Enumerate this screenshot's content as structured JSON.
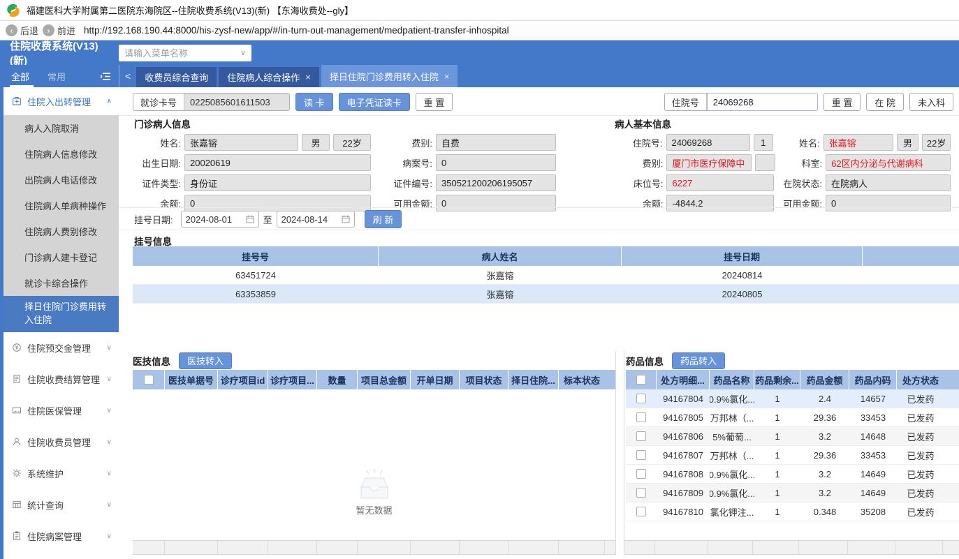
{
  "window": {
    "title": "福建医科大学附属第二医院东海院区--住院收费系统(V13)(新) 【东海收费处--gly】"
  },
  "browser": {
    "back": "后退",
    "forward": "前进",
    "url": "http://192.168.190.44:8000/his-zysf-new/app/#/in-turn-out-management/medpatient-transfer-inhospital"
  },
  "header": {
    "app_title": "住院收费系统(V13)(新)",
    "menu_search_placeholder": "请输入菜单名称"
  },
  "icons": {
    "caret_up": "∧",
    "caret_down": "∨",
    "search_caret": "∨",
    "chevron_left": "<",
    "close": "×",
    "back_arrow": "‹",
    "forward_arrow": "›"
  },
  "nav": {
    "filter_all": "全部",
    "filter_common": "常用",
    "tabs": [
      {
        "label": "收费员综合查询",
        "closable": false,
        "active": false
      },
      {
        "label": "住院病人综合操作",
        "closable": true,
        "active": false
      },
      {
        "label": "择日住院门诊费用转入住院",
        "closable": true,
        "active": true
      }
    ]
  },
  "sidebar": {
    "group_top": {
      "label": "住院入出转管理",
      "icon": "inout-manage-icon"
    },
    "items": [
      "病人入院取消",
      "住院病人信息修改",
      "出院病人电话修改",
      "住院病人单病种操作",
      "住院病人费别修改",
      "门诊病人建卡登记",
      "就诊卡综合操作",
      "择日住院门诊费用转入住院"
    ],
    "selected_index": 7,
    "groups": [
      {
        "label": "住院预交金管理",
        "icon": "deposit-icon"
      },
      {
        "label": "住院收费结算管理",
        "icon": "billing-icon"
      },
      {
        "label": "住院医保管理",
        "icon": "insurance-card-icon"
      },
      {
        "label": "住院收费员管理",
        "icon": "cashier-icon"
      },
      {
        "label": "系统维护",
        "icon": "gear-icon"
      },
      {
        "label": "统计查询",
        "icon": "stats-icon"
      },
      {
        "label": "住院病案管理",
        "icon": "records-icon"
      }
    ]
  },
  "toolbar": {
    "card_label": "就诊卡号",
    "card_value": "0225085601611503",
    "read_card": "读 卡",
    "e_cert_read": "电子凭证读卡",
    "reset": "重 置",
    "inpatient_label": "住院号",
    "inpatient_value": "24069268",
    "reset2": "重 置",
    "in_hospital": "在 院",
    "not_in_dept": "未入科"
  },
  "outpatient": {
    "title": "门诊病人信息",
    "name_label": "姓名:",
    "name": "张嘉镕",
    "sex": "男",
    "age": "22岁",
    "fee_label": "费别:",
    "fee": "自费",
    "birth_label": "出生日期:",
    "birth": "20020619",
    "case_label": "病案号:",
    "case_no": "0",
    "idtype_label": "证件类型:",
    "idtype": "身份证",
    "idno_label": "证件编号:",
    "idno": "350521200206195057",
    "balance_label": "余额:",
    "balance": "0",
    "avail_label": "可用金额:",
    "avail": "0"
  },
  "inpatient": {
    "title": "病人基本信息",
    "no_label": "住院号:",
    "no": "24069268",
    "times": "1",
    "name_label": "姓名:",
    "name": "张嘉镕",
    "sex": "男",
    "age": "22岁",
    "fee_label": "费别:",
    "fee": "厦门市医疗保障中",
    "dept_label": "科室:",
    "dept": "62区内分泌与代谢病科",
    "bed_label": "床位号:",
    "bed": "6227",
    "status_label": "在院状态:",
    "status": "在院病人",
    "balance_label": "余额:",
    "balance": "-4844.2",
    "avail_label": "可用金额:",
    "avail": "0"
  },
  "reg_filter": {
    "label": "挂号日期:",
    "from": "2024-08-01",
    "to_word": "至",
    "to": "2024-08-14",
    "refresh": "刷 新"
  },
  "reg_table": {
    "title": "挂号信息",
    "headers": [
      "挂号号",
      "病人姓名",
      "挂号日期",
      ""
    ],
    "rows": [
      [
        "63451724",
        "张嘉镕",
        "20240814"
      ],
      [
        "63353859",
        "张嘉镕",
        "20240805"
      ]
    ]
  },
  "medtech": {
    "title": "医技信息",
    "transfer_btn": "医技转入",
    "headers": [
      "医技单据号",
      "诊疗项目id",
      "诊疗项目...",
      "数量",
      "项目总金额",
      "开单日期",
      "项目状态",
      "择日住院...",
      "标本状态"
    ],
    "empty_text": "暂无数据"
  },
  "drugs": {
    "title": "药品信息",
    "transfer_btn": "药品转入",
    "headers": [
      "处方明细...",
      "药品名称",
      "药品剩余...",
      "药品金额",
      "药品内码",
      "处方状态"
    ],
    "rows": [
      [
        "94167804",
        "0.9%氯化...",
        "1",
        "2.4",
        "14657",
        "已发药"
      ],
      [
        "94167805",
        "万邦林（...",
        "1",
        "29.36",
        "33453",
        "已发药"
      ],
      [
        "94167806",
        "5%葡萄...",
        "1",
        "3.2",
        "14648",
        "已发药"
      ],
      [
        "94167807",
        "万邦林（...",
        "1",
        "29.36",
        "33453",
        "已发药"
      ],
      [
        "94167808",
        "0.9%氯化...",
        "1",
        "3.2",
        "14649",
        "已发药"
      ],
      [
        "94167809",
        "0.9%氯化...",
        "1",
        "3.2",
        "14649",
        "已发药"
      ],
      [
        "94167810",
        "氯化钾注...",
        "1",
        "0.348",
        "35208",
        "已发药"
      ]
    ]
  }
}
